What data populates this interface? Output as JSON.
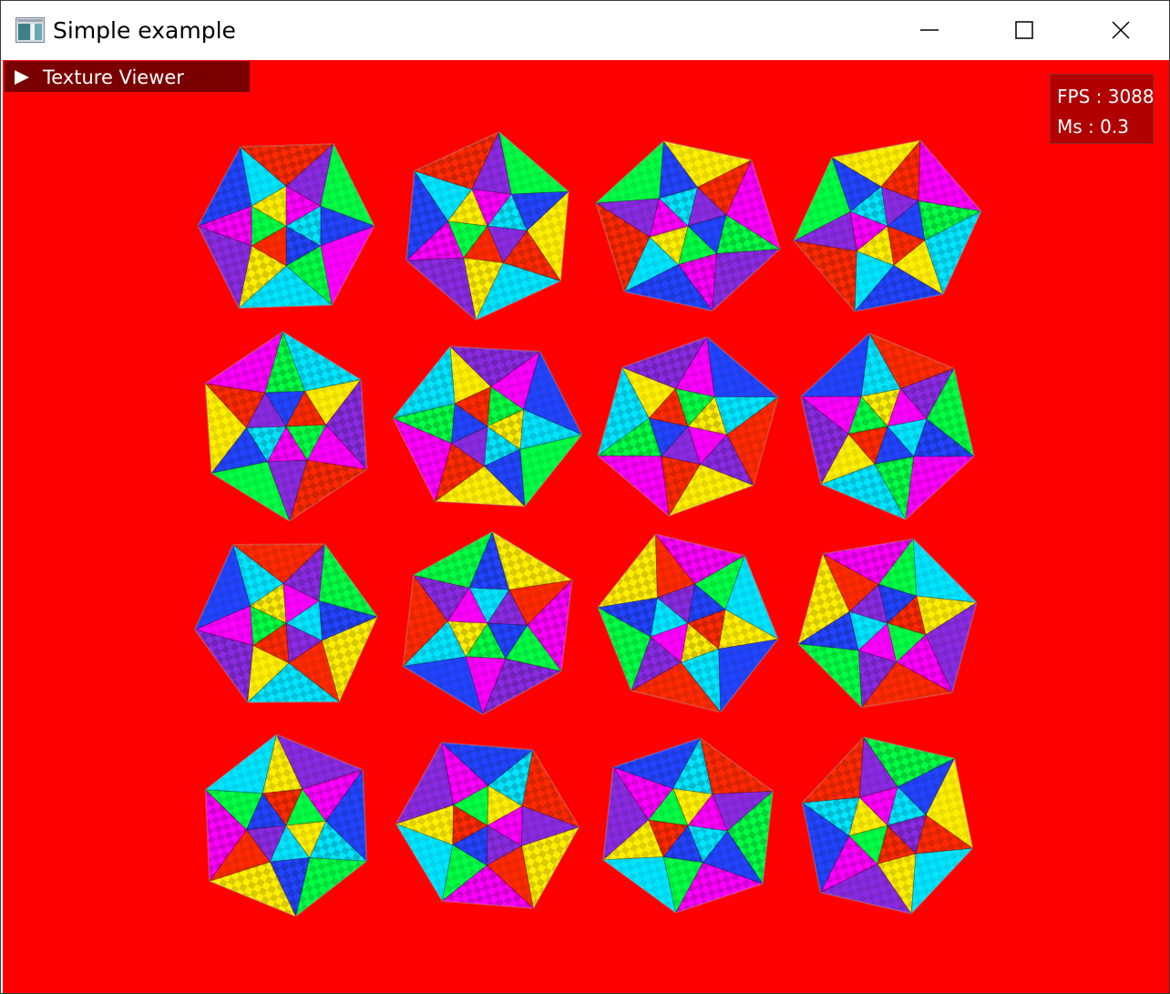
{
  "window": {
    "title": "Simple example",
    "controls": {
      "minimize": "minimize-icon",
      "maximize": "maximize-icon",
      "close": "close-icon"
    }
  },
  "texture_viewer": {
    "label": "Texture Viewer",
    "expanded": false,
    "icon": "triangle-right-icon"
  },
  "stats": {
    "fps_line": "FPS : 3088",
    "ms_line": "Ms  : 0.3"
  },
  "scene": {
    "background_color": "#ff0000",
    "object_shape": "textured icosahedron",
    "rows": 4,
    "columns": 4,
    "palette": [
      "#ff00ff",
      "#00ff44",
      "#2244ff",
      "#00e5ff",
      "#ffee00",
      "#ff2a00",
      "#8a2be2"
    ]
  }
}
